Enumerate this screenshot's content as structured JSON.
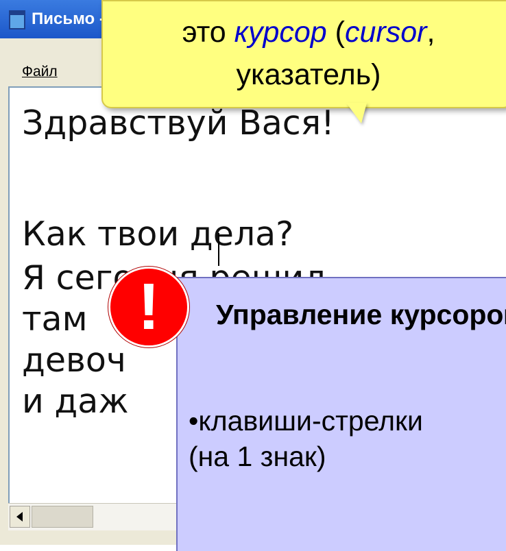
{
  "window": {
    "title": "Письмо - Блокнот",
    "menu_file": "Файл"
  },
  "editor": {
    "lines": [
      "Здравствуй Вася!",
      "",
      "Как твои дела?",
      "Я сегодня решил",
      "там",
      "девоч",
      "и даж"
    ]
  },
  "callout": {
    "prefix": "это ",
    "term": "курсор",
    "open": " (",
    "term_en": "cursor",
    "rest": ",",
    "line2": "указатель)"
  },
  "panel": {
    "title": "Управление курсором",
    "bullet_line1": "•клавиши-стрелки",
    "bullet_line2": "(на 1 знак)",
    "alert_mark": "!"
  },
  "colors": {
    "callout_bg": "#ffff80",
    "panel_bg": "#ccccff",
    "alert": "#ff0000",
    "italic_term": "#0000cc"
  }
}
